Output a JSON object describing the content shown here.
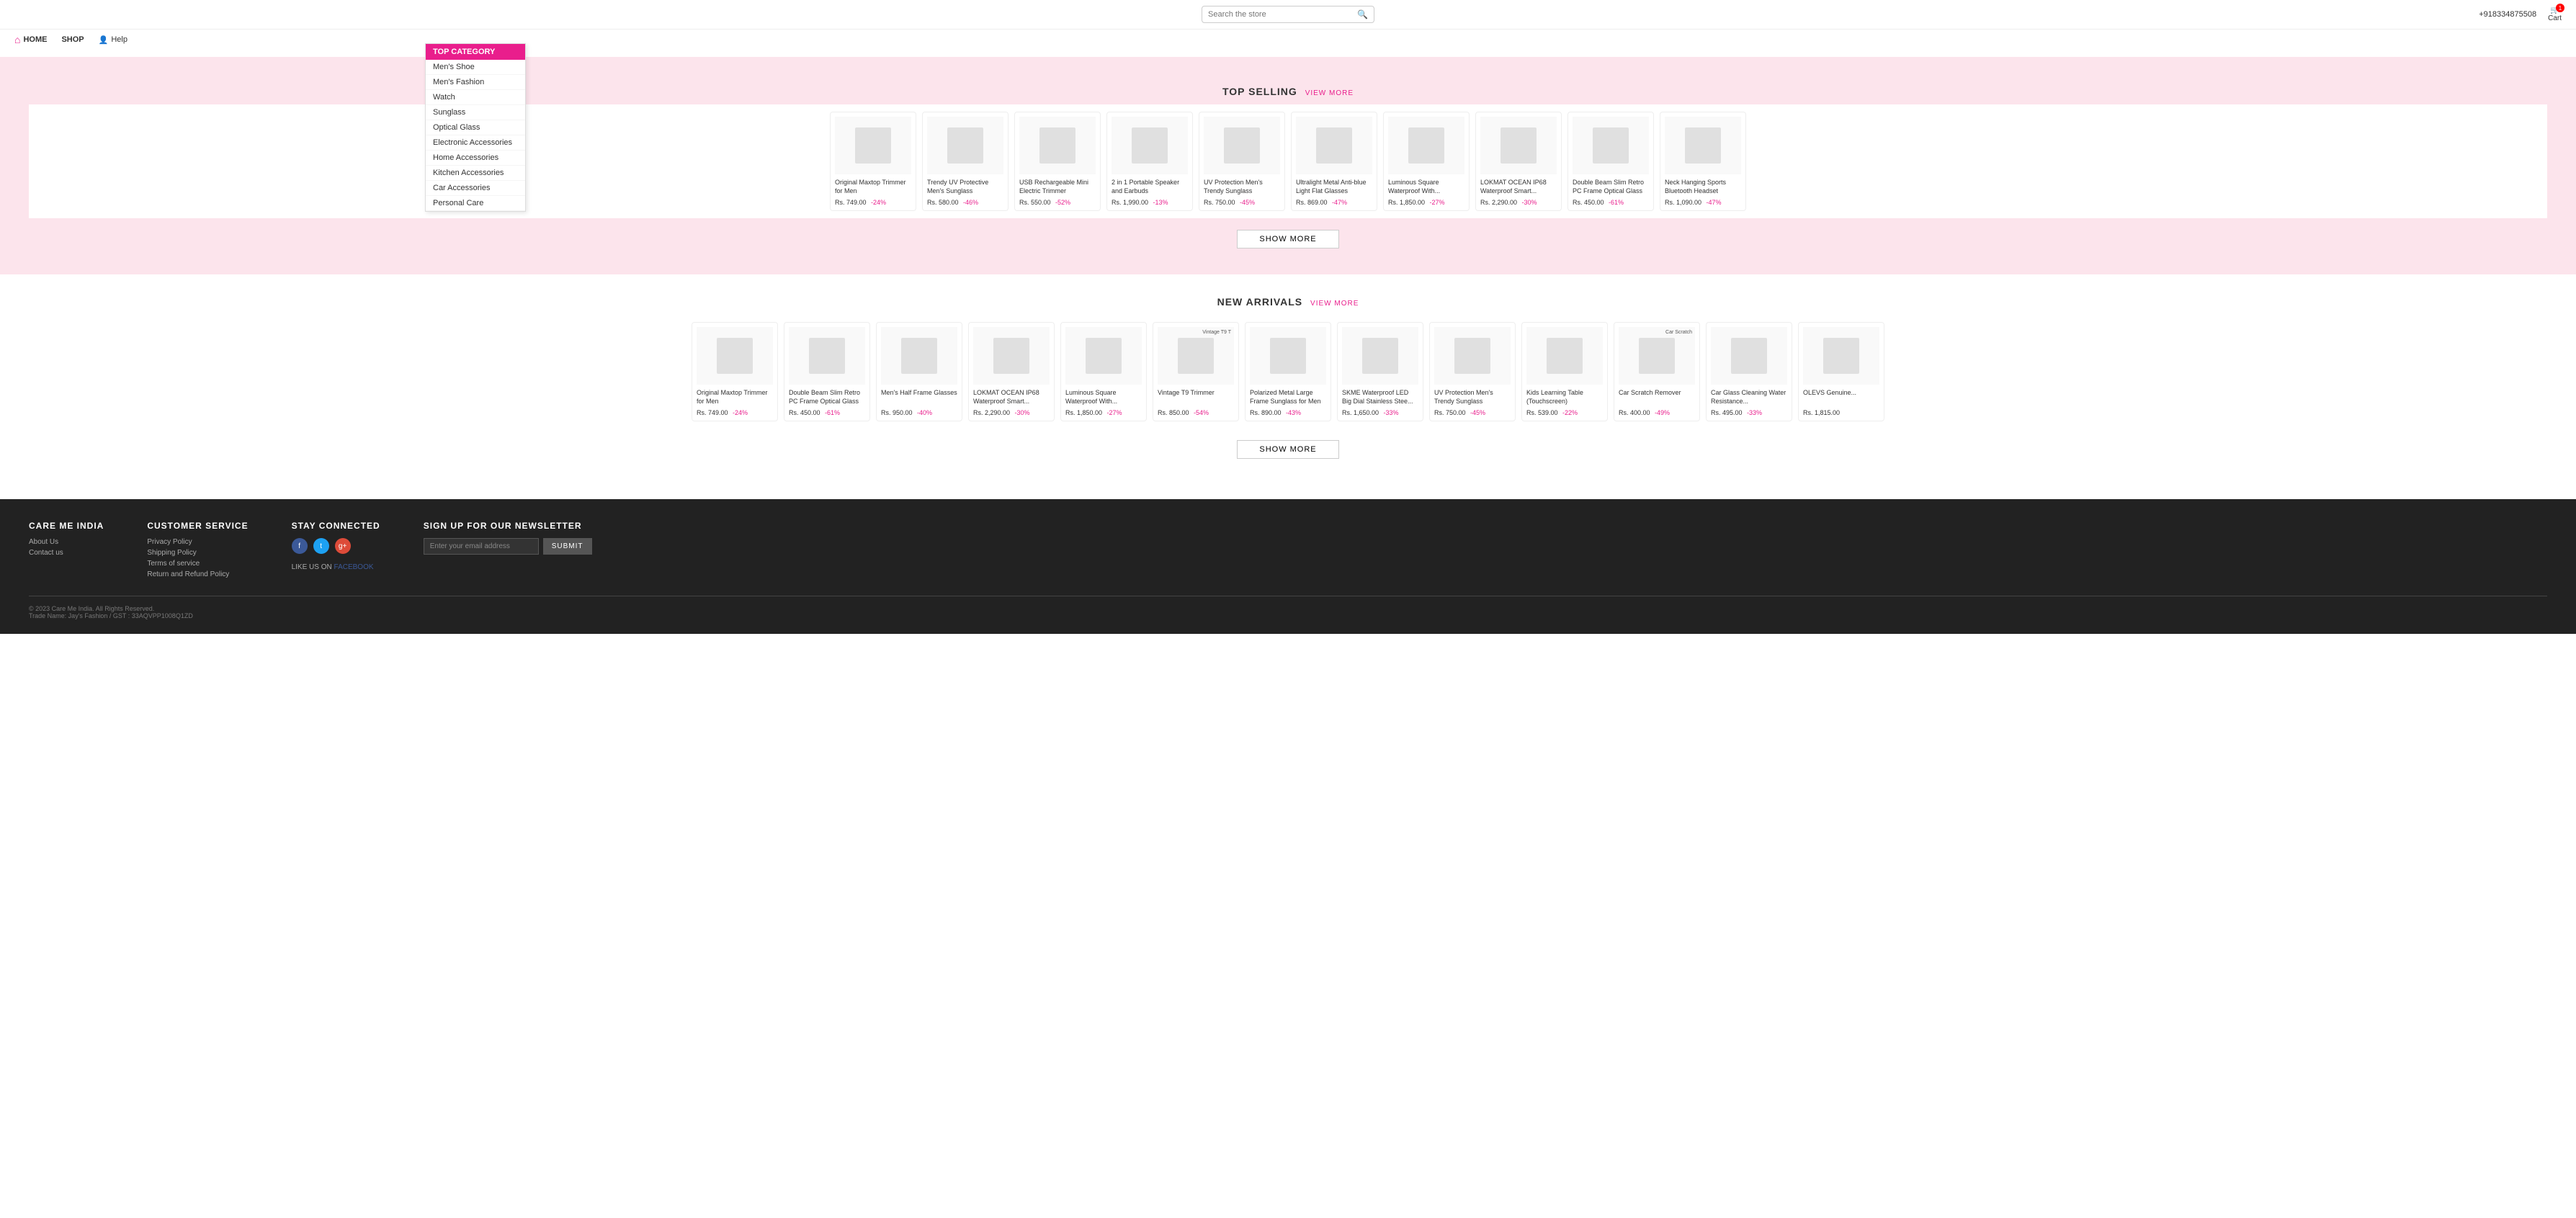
{
  "header": {
    "search_placeholder": "Search the store",
    "phone": "+918334875508",
    "cart_label": "Cart",
    "cart_count": "1"
  },
  "nav": {
    "home_label": "HOME",
    "shop_label": "SHOP",
    "help_label": "Help"
  },
  "category": {
    "title": "TOP CATEGORY",
    "items": [
      "Men's Shoe",
      "Men's Fashion",
      "Watch",
      "Sunglass",
      "Optical Glass",
      "Electronic Accessories",
      "Home Accessories",
      "Kitchen Accessories",
      "Car Accessories",
      "Personal Care"
    ]
  },
  "top_selling": {
    "title": "TOP SELLING",
    "view_more": "View More",
    "show_more": "SHOW MORE",
    "products": [
      {
        "name": "Original Maxtop Trimmer for Men",
        "price": "Rs. 749.00",
        "discount": "-24%"
      },
      {
        "name": "Trendy UV Protective Men's Sunglass",
        "price": "Rs. 580.00",
        "discount": "-46%"
      },
      {
        "name": "USB Rechargeable Mini Electric Trimmer",
        "price": "Rs. 550.00",
        "discount": "-52%"
      },
      {
        "name": "2 in 1 Portable Speaker and Earbuds",
        "price": "Rs. 1,990.00",
        "discount": "-13%"
      },
      {
        "name": "UV Protection Men's Trendy Sunglass",
        "price": "Rs. 750.00",
        "discount": "-45%"
      },
      {
        "name": "Ultralight Metal Anti-blue Light Flat Glasses",
        "price": "Rs. 869.00",
        "discount": "-47%"
      },
      {
        "name": "Luminous Square Waterproof With...",
        "price": "Rs. 1,850.00",
        "discount": "-27%"
      },
      {
        "name": "LOKMAT OCEAN IP68 Waterproof Smart...",
        "price": "Rs. 2,290.00",
        "discount": "-30%"
      },
      {
        "name": "Double Beam Slim Retro PC Frame Optical Glass",
        "price": "Rs. 450.00",
        "discount": "-61%"
      },
      {
        "name": "Neck Hanging Sports Bluetooth Headset",
        "price": "Rs. 1,090.00",
        "discount": "-47%"
      }
    ]
  },
  "new_arrivals": {
    "title": "NEW ARRIVALS",
    "view_more": "View More",
    "show_more": "SHOW MORE",
    "products": [
      {
        "name": "Original Maxtop Trimmer for Men",
        "price": "Rs. 749.00",
        "discount": "-24%"
      },
      {
        "name": "Double Beam Slim Retro PC Frame Optical Glass",
        "price": "Rs. 450.00",
        "discount": "-61%"
      },
      {
        "name": "Men's Half Frame Glasses",
        "price": "Rs. 950.00",
        "discount": "-40%"
      },
      {
        "name": "LOKMAT OCEAN IP68 Waterproof Smart...",
        "price": "Rs. 2,290.00",
        "discount": "-30%"
      },
      {
        "name": "Luminous Square Waterproof With...",
        "price": "Rs. 1,850.00",
        "discount": "-27%"
      },
      {
        "name": "Vintage T9 Trimmer",
        "price": "Rs. 850.00",
        "discount": "-54%",
        "badge": "Vintage T9 T"
      },
      {
        "name": "Polarized Metal Large Frame Sunglass for Men",
        "price": "Rs. 890.00",
        "discount": "-43%"
      },
      {
        "name": "SKME Waterproof LED Big Dial Stainless Stee...",
        "price": "Rs. 1,650.00",
        "discount": "-33%"
      },
      {
        "name": "UV Protection Men's Trendy Sunglass",
        "price": "Rs. 750.00",
        "discount": "-45%"
      },
      {
        "name": "Kids Learning Table (Touchscreen)",
        "price": "Rs. 539.00",
        "discount": "-22%"
      },
      {
        "name": "Car Scratch Remover",
        "price": "Rs. 400.00",
        "discount": "-49%",
        "badge": "Car Scratch"
      },
      {
        "name": "Car Glass Cleaning Water Resistance...",
        "price": "Rs. 495.00",
        "discount": "-33%"
      },
      {
        "name": "OLEVS Genuine...",
        "price": "Rs. 1,815.00",
        "discount": ""
      }
    ]
  },
  "footer": {
    "brand": "CARE ME INDIA",
    "about_label": "About Us",
    "contact_label": "Contact us",
    "customer_service_label": "CUSTOMER SERVICE",
    "privacy_label": "Privacy Policy",
    "shipping_label": "Shipping Policy",
    "terms_label": "Terms of service",
    "return_label": "Return and Refund Policy",
    "stay_connected_label": "STAY CONNECTED",
    "like_us": "LIKE US ON",
    "facebook": "FACEBOOK",
    "newsletter_label": "SIGN UP FOR OUR NEWSLETTER",
    "newsletter_placeholder": "Enter your email address",
    "submit_label": "SUBMIT",
    "copyright": "© 2023 Care Me India. All Rights Reserved.",
    "trade_name": "Trade Name: Jay's Fashion / GST : 33AQVPP1008Q1ZD"
  }
}
